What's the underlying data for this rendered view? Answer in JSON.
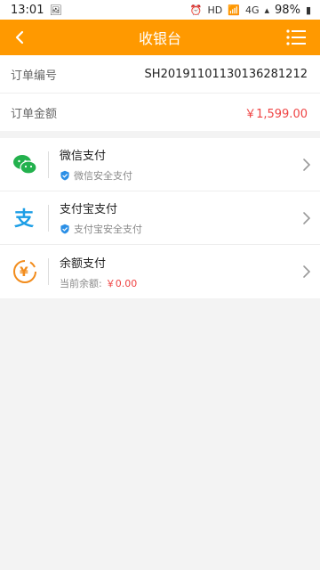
{
  "status": {
    "time": "13:01",
    "battery": "98%",
    "hd": "HD",
    "network": "4G"
  },
  "header": {
    "title": "收银台"
  },
  "order": {
    "number_label": "订单编号",
    "number_value": "SH20191101130136281212",
    "amount_label": "订单金额",
    "amount_value": "￥1,599.00"
  },
  "payments": [
    {
      "title": "微信支付",
      "subtitle": "微信安全支付",
      "icon": "wechat-icon"
    },
    {
      "title": "支付宝支付",
      "subtitle": "支付宝安全支付",
      "icon": "alipay-icon"
    },
    {
      "title": "余额支付",
      "subtitle_label": "当前余额:",
      "balance_value": "￥0.00",
      "icon": "balance-icon"
    }
  ],
  "colors": {
    "accent": "#ff9900",
    "price": "#ef4444",
    "wechat": "#23b14d",
    "alipay": "#1c9ee6",
    "shield": "#2b8fe6"
  }
}
